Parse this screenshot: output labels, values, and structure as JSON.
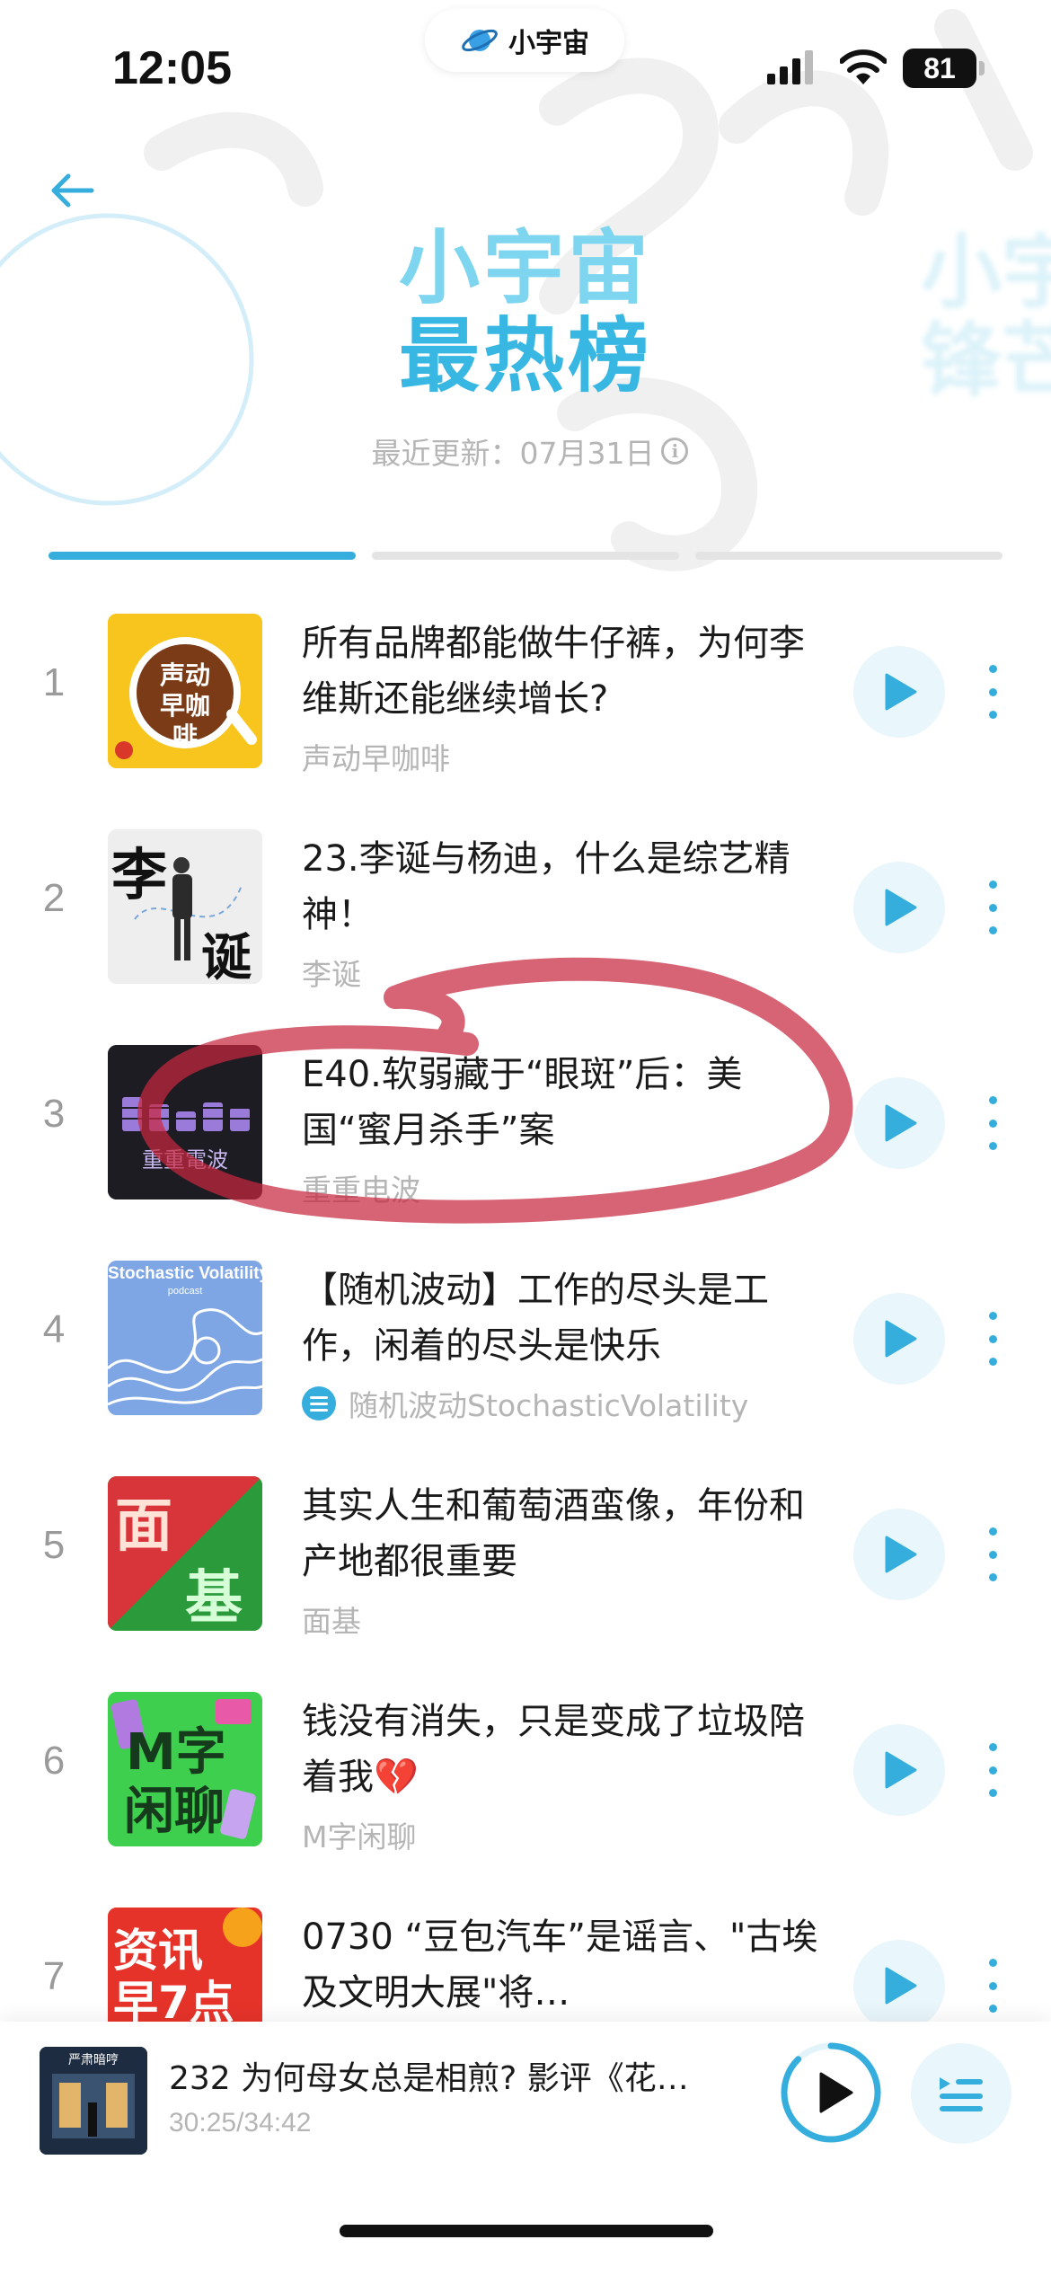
{
  "status_bar": {
    "time": "12:05",
    "app_name": "小宇宙",
    "battery": "81"
  },
  "header": {
    "title_line1": "小宇宙",
    "title_line2": "最热榜",
    "ghost_title_line1": "小宇",
    "ghost_title_line2": "锋芒",
    "updated_label": "最近更新：07月31日"
  },
  "tabs": {
    "active_color": "#35aedd",
    "inactive_color": "#e4e4e4"
  },
  "episodes": [
    {
      "rank": "1",
      "title": "所有品牌都能做牛仔裤，为何李维斯还能继续增长?",
      "podcast": "声动早咖啡",
      "cover_text": "声动早咖啡"
    },
    {
      "rank": "2",
      "title": "23.李诞与杨迪，什么是综艺精神！",
      "podcast": "李诞",
      "cover_text_a": "李",
      "cover_text_b": "诞"
    },
    {
      "rank": "3",
      "title": "E40.软弱藏于“眼斑”后：美国“蜜月杀手”案",
      "podcast": "重重电波",
      "cover_text": "重重電波"
    },
    {
      "rank": "4",
      "title": "【随机波动】工作的尽头是工作，闲着的尽头是快乐",
      "podcast": "随机波动StochasticVolatility",
      "cover_text": "Stochastic Volatility",
      "cover_sub": "podcast"
    },
    {
      "rank": "5",
      "title": "其实人生和葡萄酒蛮像，年份和产地都很重要",
      "podcast": "面基",
      "cover_text_a": "面",
      "cover_text_b": "基"
    },
    {
      "rank": "6",
      "title": "钱没有消失，只是变成了垃圾陪着我💔",
      "podcast": "M字闲聊",
      "cover_text_a": "M字",
      "cover_text_b": "闲聊"
    },
    {
      "rank": "7",
      "title": "0730 “豆包汽车”是谣言、\"古埃及文明大展\"将…",
      "podcast": "",
      "cover_text_a": "资讯",
      "cover_text_b": "早7点"
    }
  ],
  "mini_player": {
    "title": "232 为何母女总是相煎? 影评《花…",
    "time": "30:25/34:42",
    "cover_text": "严肃暗哼",
    "progress": 0.876
  },
  "colors": {
    "accent": "#35aedd",
    "annotation": "#c8283f"
  }
}
